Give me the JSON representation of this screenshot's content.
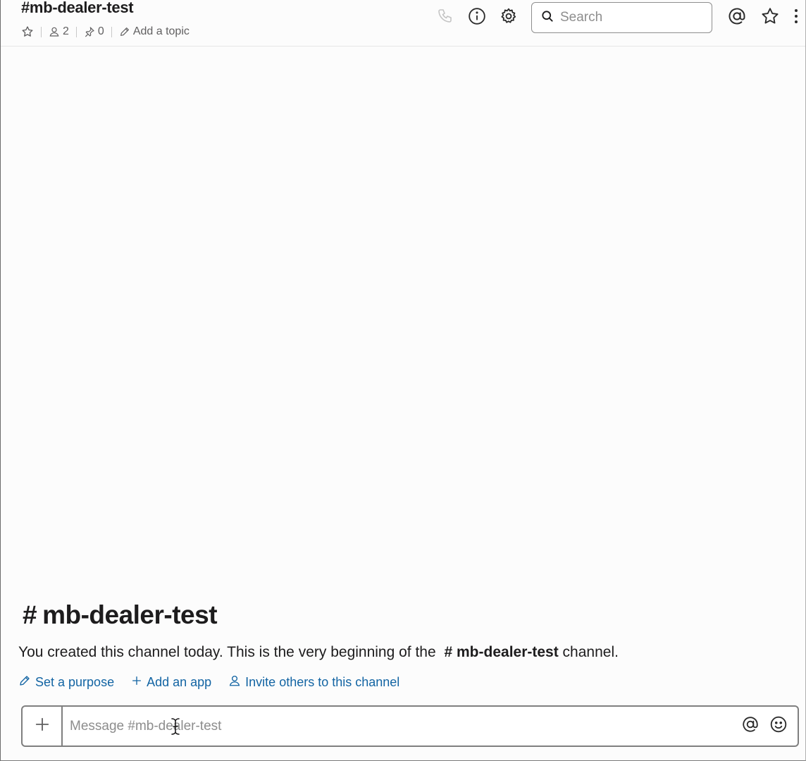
{
  "header": {
    "channel_name": "#mb-dealer-test",
    "member_count": "2",
    "pinned_count": "0",
    "topic_label": "Add a topic"
  },
  "search": {
    "placeholder": "Search"
  },
  "intro": {
    "hash": "#",
    "title": "mb-dealer-test",
    "text_before": "You created this channel today. This is the very beginning of the ",
    "channel_ref": "# mb-dealer-test",
    "text_after": " channel.",
    "actions": {
      "set_purpose": "Set a purpose",
      "add_app": "Add an app",
      "invite": "Invite others to this channel"
    }
  },
  "composer": {
    "placeholder": "Message #mb-dealer-test"
  },
  "colors": {
    "link": "#1264a3",
    "text": "#1d1c1d",
    "muted": "#616061"
  },
  "icons": [
    "star-icon",
    "person-icon",
    "pin-icon",
    "pencil-icon",
    "phone-icon",
    "info-icon",
    "gear-icon",
    "search-icon",
    "at-icon",
    "star-icon",
    "more-vertical-icon",
    "plus-icon",
    "emoji-icon"
  ]
}
